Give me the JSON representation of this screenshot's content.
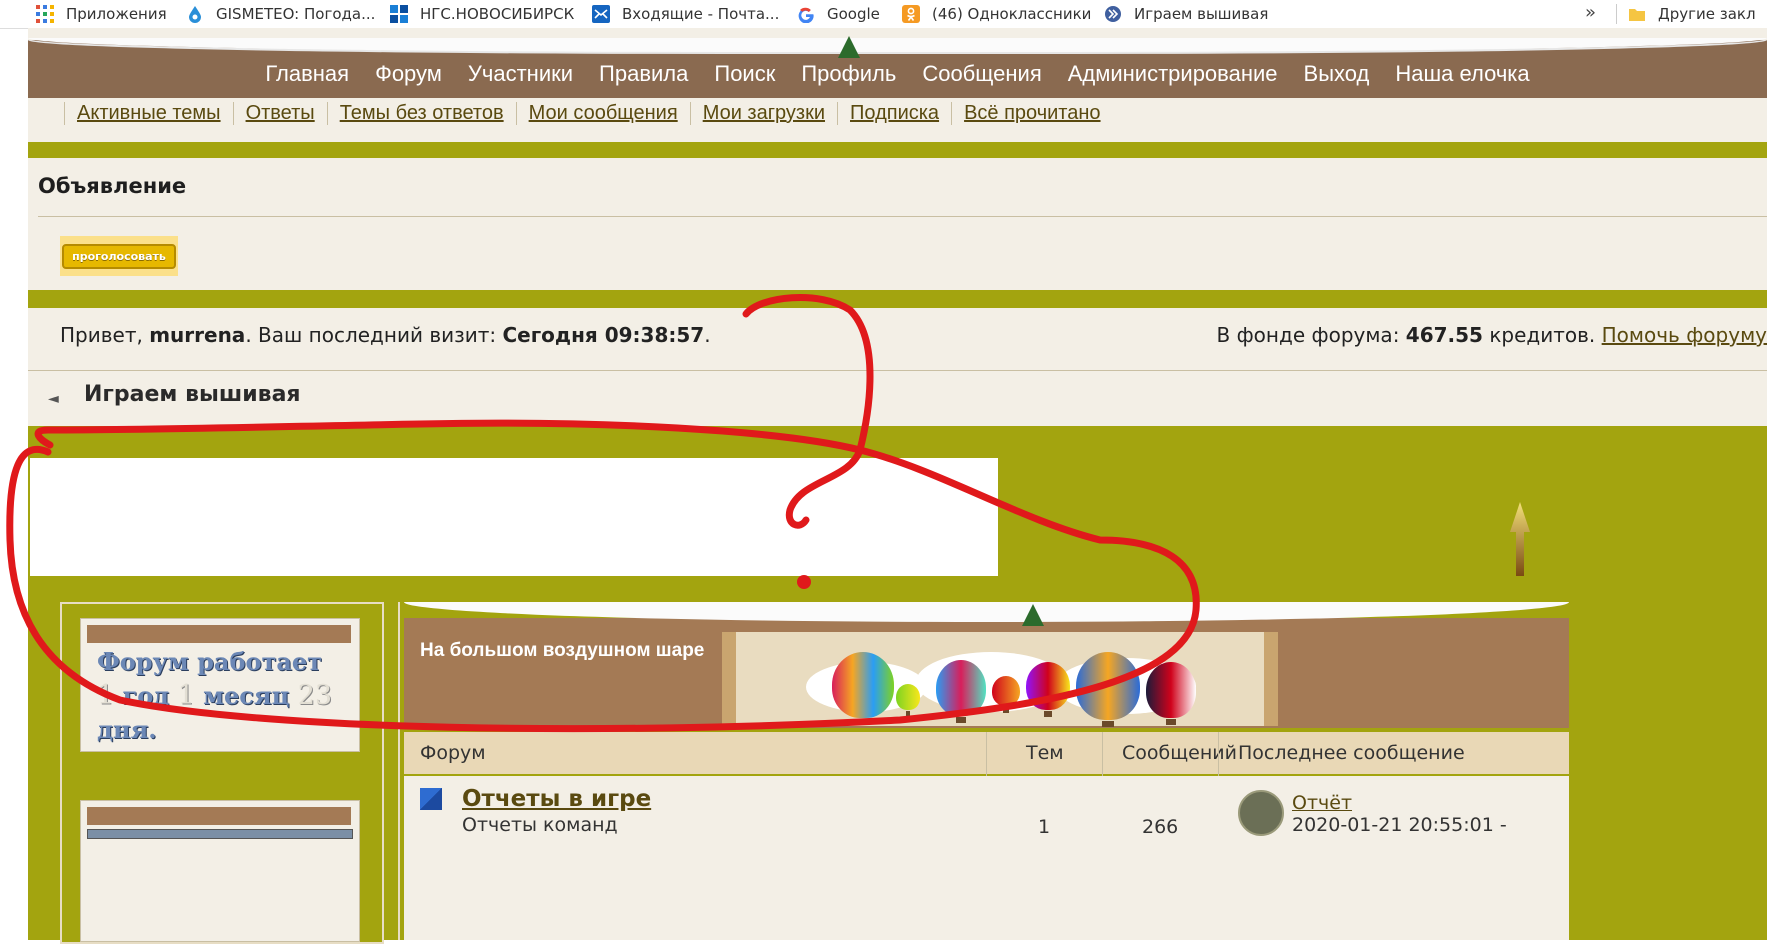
{
  "bookmarks": [
    {
      "label": "Приложения",
      "icon": "apps-grid-icon"
    },
    {
      "label": "GISMETEO: Погода...",
      "icon": "gismeteo-drop-icon"
    },
    {
      "label": "НГС.НОВОСИБИРСК",
      "icon": "ngs-logo-icon"
    },
    {
      "label": "Входящие - Почта...",
      "icon": "mail-icon"
    },
    {
      "label": "Google",
      "icon": "google-g-icon"
    },
    {
      "label": "(46) Одноклассники",
      "icon": "odnoklassniki-icon"
    },
    {
      "label": "Играем вышивая",
      "icon": "forum-favicon-icon"
    }
  ],
  "bookmarks_more": "»",
  "other_bookmarks": "Другие закл",
  "nav": [
    "Главная",
    "Форум",
    "Участники",
    "Правила",
    "Поиск",
    "Профиль",
    "Сообщения",
    "Администрирование",
    "Выход",
    "Наша елочка"
  ],
  "subnav": [
    "Активные темы",
    "Ответы",
    "Темы без ответов",
    "Мои сообщения",
    "Мои загрузки",
    "Подписка",
    "Всё прочитано"
  ],
  "announcement": {
    "title": "Объявление",
    "vote_button": "проголосовать"
  },
  "greeting": {
    "hello": "Привет, ",
    "username": "murrena",
    "visit_prefix": ".  Ваш последний визит: ",
    "visit_value": "Сегодня 09:38:57",
    "visit_suffix": "."
  },
  "fund": {
    "prefix": "В фонде форума: ",
    "amount": "467.55",
    "suffix": " кредитов. ",
    "help_link": "Помочь форуму"
  },
  "breadcrumb": {
    "home_icon": "home-arrow-icon",
    "title": "Играем вышивая"
  },
  "counter": {
    "w1": "Форум работает ",
    "n1": "1",
    "w2": " год ",
    "n2": "1",
    "w3": " месяц ",
    "n3": "23",
    "w4": " дня."
  },
  "forum_section": {
    "title": "На большом воздушном шаре"
  },
  "table": {
    "headers": {
      "forum": "Форум",
      "topics": "Тем",
      "posts": "Сообщений",
      "last": "Последнее сообщение"
    },
    "rows": [
      {
        "name": "Отчеты в игре",
        "desc": "Отчеты команд",
        "topics": "1",
        "posts": "266",
        "last_link": "Отчёт",
        "last_date": "2020-01-21 20:55:01 -"
      }
    ]
  },
  "colors": {
    "olive": "#a3a40f",
    "brown": "#8a6a50",
    "cream": "#f3efe6",
    "annotation_red": "#e0191b"
  }
}
